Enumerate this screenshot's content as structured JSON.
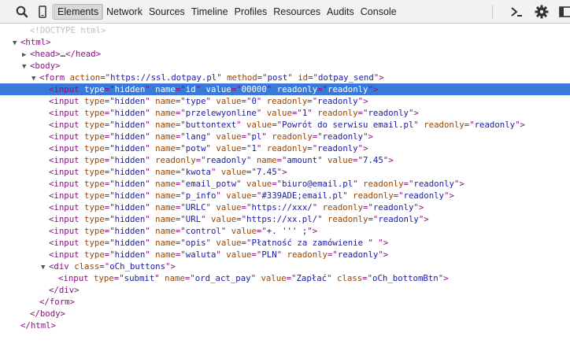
{
  "toolbar": {
    "tabs": [
      "Elements",
      "Network",
      "Sources",
      "Timeline",
      "Profiles",
      "Resources",
      "Audits",
      "Console"
    ],
    "active_tab": "Elements",
    "icons": [
      "search-icon",
      "device-mode-icon",
      "console-drawer-icon",
      "gear-icon",
      "dock-icon"
    ],
    "colors": {
      "selection": "#3879d9",
      "tag": "#881280",
      "attr_name": "#994500",
      "attr_value": "#1a1aa6"
    }
  },
  "doctype": "<!DOCTYPE html>",
  "html_open": "<html>",
  "head": {
    "open": "<head>",
    "ellipsis": "…",
    "close": "</head>"
  },
  "body_open": "<body>",
  "form": {
    "open": "<form",
    "action": "https://ssl.dotpay.pl",
    "method": "post",
    "id": "dotpay_send"
  },
  "inputs": [
    {
      "attrs": [
        [
          "type",
          "hidden"
        ],
        [
          "name",
          "id"
        ],
        [
          "value",
          "00000"
        ],
        [
          "readonly",
          "readonly"
        ]
      ]
    },
    {
      "attrs": [
        [
          "type",
          "hidden"
        ],
        [
          "name",
          "type"
        ],
        [
          "value",
          "0"
        ],
        [
          "readonly",
          "readonly"
        ]
      ]
    },
    {
      "attrs": [
        [
          "type",
          "hidden"
        ],
        [
          "name",
          "przelewyonline"
        ],
        [
          "value",
          "1"
        ],
        [
          "readonly",
          "readonly"
        ]
      ]
    },
    {
      "attrs": [
        [
          "type",
          "hidden"
        ],
        [
          "name",
          "buttontext"
        ],
        [
          "value",
          "Powrót do serwisu email.pl"
        ],
        [
          "readonly",
          "readonly"
        ]
      ]
    },
    {
      "attrs": [
        [
          "type",
          "hidden"
        ],
        [
          "name",
          "lang"
        ],
        [
          "value",
          "pl"
        ],
        [
          "readonly",
          "readonly"
        ]
      ]
    },
    {
      "attrs": [
        [
          "type",
          "hidden"
        ],
        [
          "name",
          "potw"
        ],
        [
          "value",
          "1"
        ],
        [
          "readonly",
          "readonly"
        ]
      ]
    },
    {
      "attrs": [
        [
          "type",
          "hidden"
        ],
        [
          "readonly",
          "readonly"
        ],
        [
          "name",
          "amount"
        ],
        [
          "value",
          "7.45"
        ]
      ]
    },
    {
      "attrs": [
        [
          "type",
          "hidden"
        ],
        [
          "name",
          "kwota"
        ],
        [
          "value",
          "7.45"
        ]
      ]
    },
    {
      "attrs": [
        [
          "type",
          "hidden"
        ],
        [
          "name",
          "email_potw"
        ],
        [
          "value",
          "biuro@email.pl"
        ],
        [
          "readonly",
          "readonly"
        ]
      ]
    },
    {
      "attrs": [
        [
          "type",
          "hidden"
        ],
        [
          "name",
          "p_info"
        ],
        [
          "value",
          "#339ADE;email.pl"
        ],
        [
          "readonly",
          "readonly"
        ]
      ]
    },
    {
      "attrs": [
        [
          "type",
          "hidden"
        ],
        [
          "name",
          "URLC"
        ],
        [
          "value",
          "https://xxx/"
        ],
        [
          "readonly",
          "readonly"
        ]
      ]
    },
    {
      "attrs": [
        [
          "type",
          "hidden"
        ],
        [
          "name",
          "URL"
        ],
        [
          "value",
          "https://xx.pl/"
        ],
        [
          "readonly",
          "readonly"
        ]
      ]
    },
    {
      "attrs": [
        [
          "type",
          "hidden"
        ],
        [
          "name",
          "control"
        ],
        [
          "value",
          "+. ''' ;"
        ]
      ]
    },
    {
      "attrs": [
        [
          "type",
          "hidden"
        ],
        [
          "name",
          "opis"
        ],
        [
          "value",
          "Płatność za zamówienie \" "
        ]
      ]
    },
    {
      "attrs": [
        [
          "type",
          "hidden"
        ],
        [
          "name",
          "waluta"
        ],
        [
          "value",
          "PLN"
        ],
        [
          "readonly",
          "readonly"
        ]
      ]
    }
  ],
  "div": {
    "open": "<div",
    "class": "oCh_buttons",
    "close": "</div>"
  },
  "submit": {
    "attrs": [
      [
        "type",
        "submit"
      ],
      [
        "name",
        "ord_act_pay"
      ],
      [
        "value",
        "Zapłać"
      ],
      [
        "class",
        "oCh_bottomBtn"
      ]
    ]
  },
  "form_close": "</form>",
  "body_close": "</body>",
  "html_close": "</html>"
}
